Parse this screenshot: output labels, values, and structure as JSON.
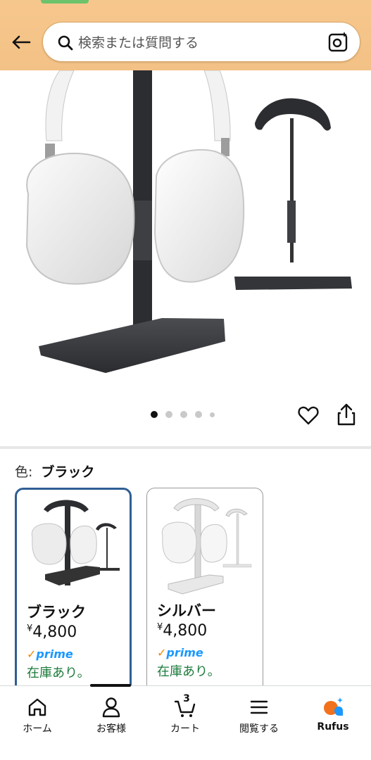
{
  "search": {
    "placeholder": "検索または質問する"
  },
  "gallery": {
    "image_count": 5,
    "active_index": 0
  },
  "color": {
    "label": "色:",
    "selected": "ブラック"
  },
  "variants": [
    {
      "name": "ブラック",
      "currency": "¥",
      "price": "4,800",
      "prime": "prime",
      "stock": "在庫あり。"
    },
    {
      "name": "シルバー",
      "currency": "¥",
      "price": "4,800",
      "prime": "prime",
      "stock": "在庫あり。"
    }
  ],
  "bottom_nav": {
    "items": [
      {
        "label": "ホーム",
        "icon": "home-icon"
      },
      {
        "label": "お客様",
        "icon": "account-icon"
      },
      {
        "label": "カート",
        "icon": "cart-icon",
        "count": "3"
      },
      {
        "label": "閲覧する",
        "icon": "menu-icon"
      },
      {
        "label": "Rufus",
        "icon": "rufus-icon"
      }
    ]
  },
  "colors": {
    "header": "#f3c185",
    "selected_border": "#2f5e94",
    "prime": "#1a98ff",
    "stock": "#1a7a3a"
  }
}
